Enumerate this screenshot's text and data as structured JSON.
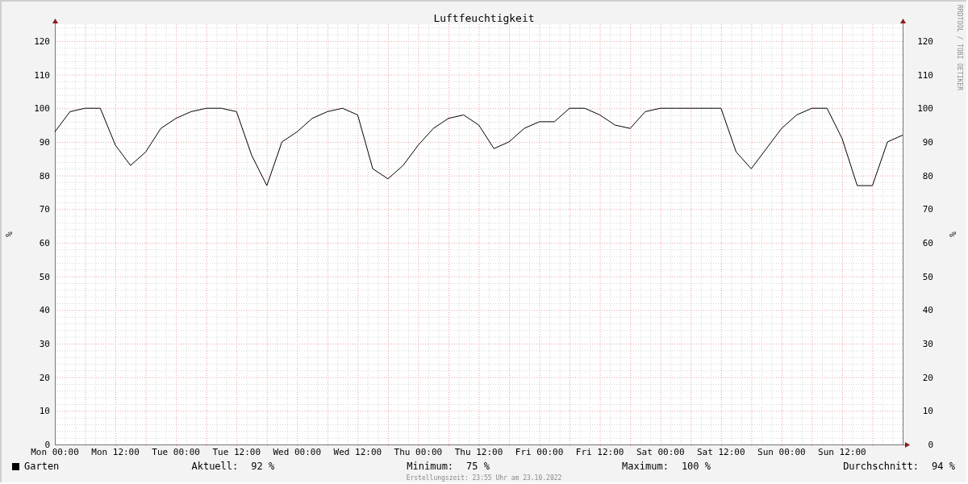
{
  "title": "Luftfeuchtigkeit",
  "watermark": "RRDTOOL / TOBI OETIKER",
  "chart_data": {
    "type": "line",
    "ylabel": "%",
    "y2label": "%",
    "grid": true,
    "ylim": [
      0,
      125
    ],
    "categories": [
      "Mon 00:00",
      null,
      null,
      null,
      "Mon 12:00",
      null,
      null,
      null,
      "Tue 00:00",
      null,
      null,
      null,
      "Tue 12:00",
      null,
      null,
      null,
      "Wed 00:00",
      null,
      null,
      null,
      "Wed 12:00",
      null,
      null,
      null,
      "Thu 00:00",
      null,
      null,
      null,
      "Thu 12:00",
      null,
      null,
      null,
      "Fri 00:00",
      null,
      null,
      null,
      "Fri 12:00",
      null,
      null,
      null,
      "Sat 00:00",
      null,
      null,
      null,
      "Sat 12:00",
      null,
      null,
      null,
      "Sun 00:00",
      null,
      null,
      null,
      "Sun 12:00",
      null,
      null,
      null,
      null
    ],
    "series": [
      {
        "name": "Garten",
        "color": "#000000",
        "values": [
          93,
          99,
          100,
          100,
          89,
          83,
          87,
          94,
          97,
          99,
          100,
          100,
          99,
          86,
          77,
          90,
          93,
          97,
          99,
          100,
          98,
          82,
          79,
          83,
          89,
          94,
          97,
          98,
          95,
          88,
          90,
          94,
          96,
          96,
          100,
          100,
          98,
          95,
          94,
          99,
          100,
          100,
          100,
          100,
          100,
          87,
          82,
          88,
          94,
          98,
          100,
          100,
          91,
          77,
          77,
          90,
          92
        ]
      }
    ],
    "yticks": [
      0,
      10,
      20,
      30,
      40,
      50,
      60,
      70,
      80,
      90,
      100,
      110,
      120
    ],
    "y2ticks": [
      0,
      10,
      20,
      30,
      40,
      50,
      60,
      70,
      80,
      90,
      100,
      110,
      120
    ],
    "y2lim": [
      0,
      125
    ]
  },
  "stats": [
    {
      "label": "Aktuell:",
      "value": "92 %"
    },
    {
      "label": "Minimum:",
      "value": "75 %"
    },
    {
      "label": "Maximum:",
      "value": "100 %"
    },
    {
      "label": "Durchschnitt:",
      "value": "94 %"
    }
  ],
  "footer": "Erstellungszeit: 23:55 Uhr am 23.10.2022"
}
